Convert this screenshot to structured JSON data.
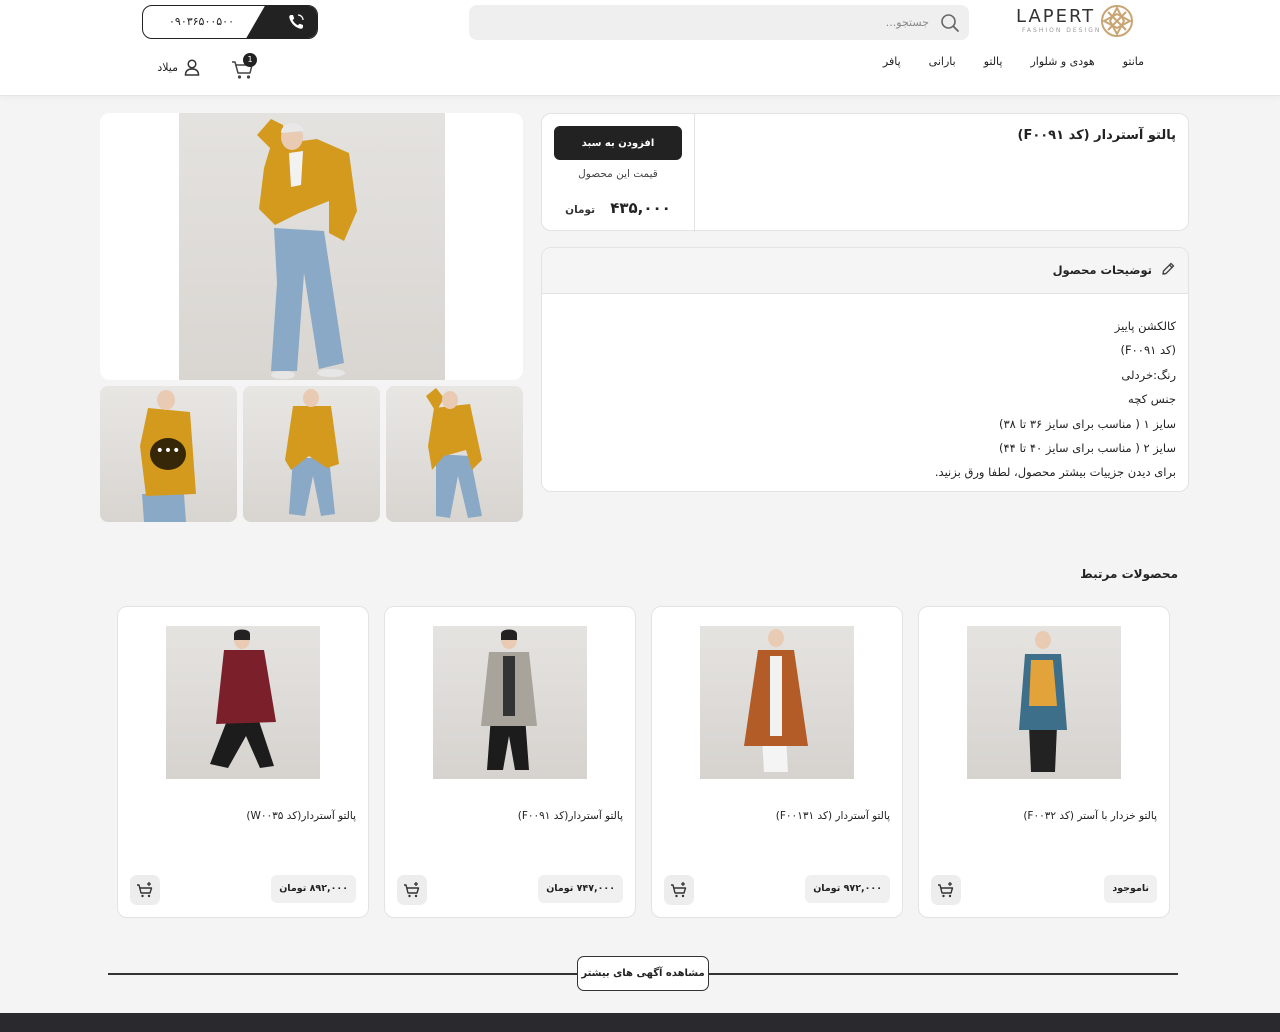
{
  "header": {
    "logo": {
      "text": "LAPERT",
      "subtitle": "FASHION DESIGN"
    },
    "search": {
      "placeholder": "جستجو..."
    },
    "phone": "۰۹۰۳۶۵۰۰۵۰۰",
    "cart_count": "1",
    "user_name": "میلاد",
    "nav": [
      "مانتو",
      "هودی و شلوار",
      "پالتو",
      "بارانی",
      "پافر"
    ]
  },
  "product": {
    "title": "پالتو آستردار (کد F۰۰۹۱)",
    "add_to_cart": "افزودن به سبد",
    "price_label": "قیمت این محصول",
    "price": "۴۳۵,۰۰۰",
    "currency": "تومان",
    "more_images": "•••"
  },
  "description": {
    "title": "توضیحات محصول",
    "lines": [
      "کالکشن پاییز",
      "(کد F۰۰۹۱)",
      "رنگ:خردلی",
      "جنس کچه",
      "سایز ۱ ( مناسب برای سایز ۳۶ تا ۳۸)",
      "سایز ۲ ( مناسب برای سایز ۴۰ تا ۴۴)",
      "برای دیدن جزییات بیشتر محصول، لطفا ورق بزنید."
    ]
  },
  "related": {
    "title": "محصولات مرتبط",
    "items": [
      {
        "name": "پالتو خزدار با آستر (کد F۰۰۳۲)",
        "price": "ناموجود",
        "coat_color": "#3d6e8a"
      },
      {
        "name": "پالتو آستردار (کد F۰۰۱۳۱)",
        "price": "۹۷۲,۰۰۰ تومان",
        "coat_color": "#b35c28"
      },
      {
        "name": "پالتو آستردار(کد F۰۰۹۱)",
        "price": "۷۴۷,۰۰۰ تومان",
        "coat_color": "#a8a39b"
      },
      {
        "name": "پالتو آستردار(کد W۰۰۳۵)",
        "price": "۸۹۲,۰۰۰ تومان",
        "coat_color": "#7b1f2a"
      }
    ]
  },
  "see_more": "مشاهده آگهی های بیشتر",
  "colors": {
    "accent": "#222222",
    "mustard": "#d49a1e",
    "jeans": "#8aa9c6"
  }
}
